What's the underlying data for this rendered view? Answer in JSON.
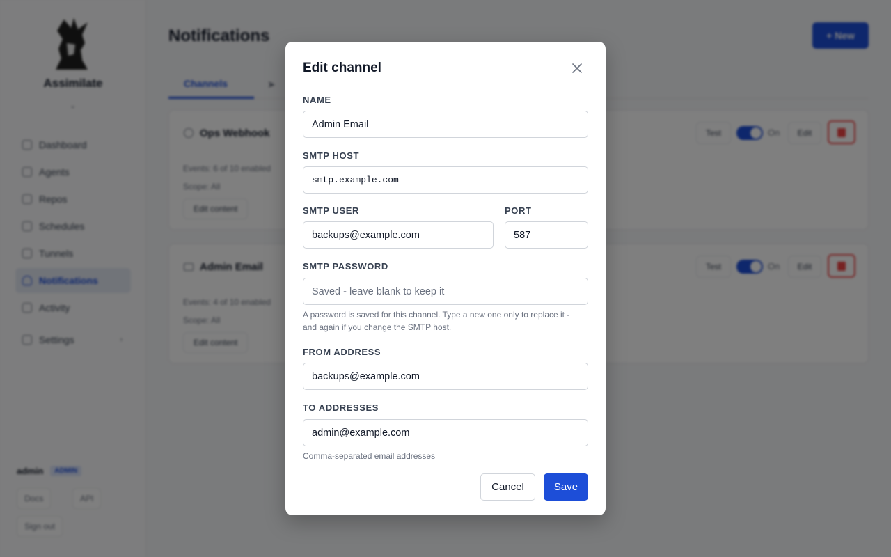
{
  "sidebar": {
    "brand": "Assimilate",
    "items": [
      {
        "label": "Dashboard"
      },
      {
        "label": "Agents"
      },
      {
        "label": "Repos"
      },
      {
        "label": "Schedules"
      },
      {
        "label": "Tunnels"
      },
      {
        "label": "Notifications"
      },
      {
        "label": "Activity"
      },
      {
        "label": "Settings"
      }
    ],
    "user": {
      "name": "admin",
      "role": "ADMIN"
    },
    "docs_label": "Docs",
    "api_label": "API",
    "signout_label": "Sign out"
  },
  "main": {
    "title": "Notifications",
    "new_button": "+ New",
    "tabs": [
      {
        "label": "Channels"
      }
    ],
    "channels": [
      {
        "name": "Ops Webhook",
        "events": "Events: 6 of 10 enabled",
        "scope": "Scope: All",
        "edit_content": "Edit content",
        "test": "Test",
        "toggle_state": "On",
        "edit": "Edit"
      },
      {
        "name": "Admin Email",
        "events": "Events: 4 of 10 enabled",
        "scope": "Scope: All",
        "edit_content": "Edit content",
        "test": "Test",
        "toggle_state": "On",
        "edit": "Edit"
      }
    ]
  },
  "modal": {
    "title": "Edit channel",
    "fields": {
      "name": {
        "label": "NAME",
        "value": "Admin Email"
      },
      "smtp_host": {
        "label": "SMTP HOST",
        "value": "smtp.example.com"
      },
      "smtp_user": {
        "label": "SMTP USER",
        "value": "backups@example.com"
      },
      "port": {
        "label": "PORT",
        "value": "587"
      },
      "smtp_password": {
        "label": "SMTP PASSWORD",
        "value": "",
        "placeholder": "Saved - leave blank to keep it",
        "hint_line1": "A password is saved for this channel. Type a new one only to replace it -",
        "hint_line2": "and again if you change the SMTP host."
      },
      "from_address": {
        "label": "FROM ADDRESS",
        "value": "backups@example.com"
      },
      "to_addresses": {
        "label": "TO ADDRESSES",
        "value": "admin@example.com",
        "hint": "Comma-separated email addresses"
      }
    },
    "cancel_label": "Cancel",
    "save_label": "Save"
  },
  "colors": {
    "accent": "#1d4ed8",
    "danger": "#ef4444",
    "overlay": "rgba(0,0,0,0.5)"
  }
}
